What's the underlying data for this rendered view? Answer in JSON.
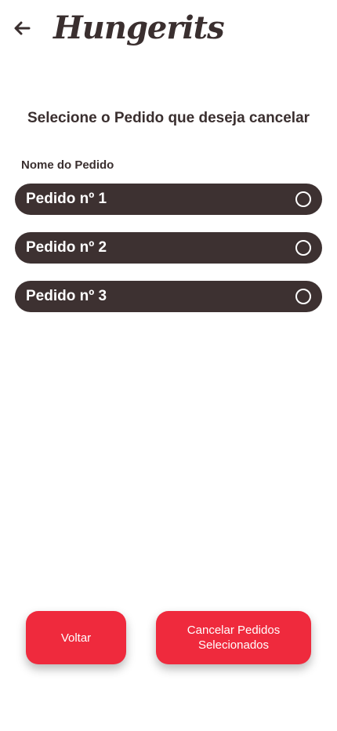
{
  "header": {
    "back_icon": "arrow-left-icon",
    "brand": "Hungerits"
  },
  "main": {
    "title": "Selecione o Pedido que deseja cancelar",
    "section_label": "Nome do Pedido",
    "orders": [
      {
        "label": "Pedido nº 1",
        "selected": false
      },
      {
        "label": "Pedido nº 2",
        "selected": false
      },
      {
        "label": "Pedido nº 3",
        "selected": false
      }
    ]
  },
  "footer": {
    "back_label": "Voltar",
    "cancel_label_line1": "Cancelar Pedidos",
    "cancel_label_line2": "Selecionados"
  },
  "colors": {
    "primary_dark": "#3d3131",
    "accent_red": "#ef2a3d",
    "background": "#ffffff"
  }
}
